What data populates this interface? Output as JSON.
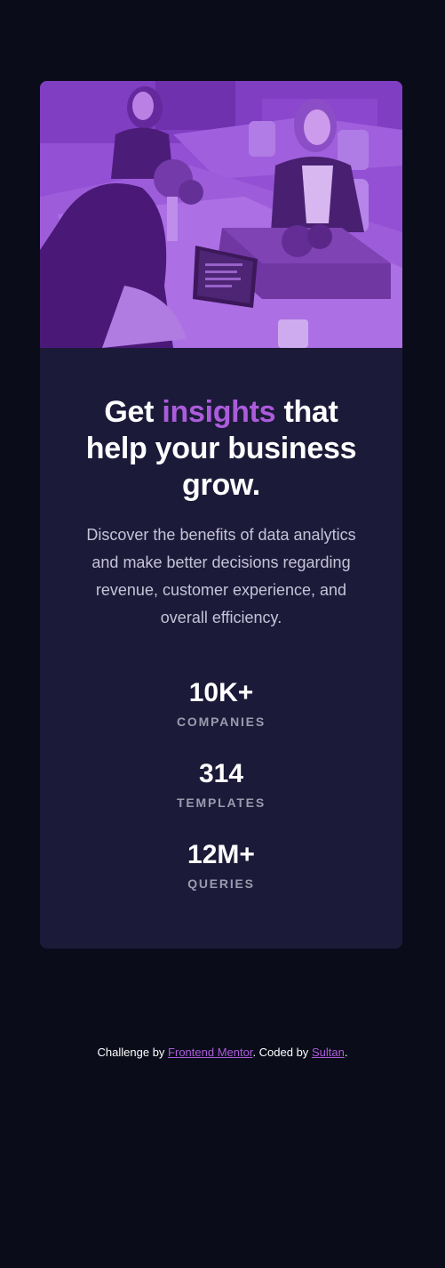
{
  "card": {
    "image_alt": "People working at laptops in an office",
    "title": {
      "part1": "Get ",
      "accent": "insights",
      "part2": " that help your business grow."
    },
    "description": "Discover the benefits of data analytics and make better decisions regarding revenue, customer experience, and overall efficiency.",
    "stats": [
      {
        "value": "10K+",
        "label": "COMPANIES"
      },
      {
        "value": "314",
        "label": "TEMPLATES"
      },
      {
        "value": "12M+",
        "label": "QUERIES"
      }
    ]
  },
  "attribution": {
    "prefix": "Challenge by ",
    "link1": "Frontend Mentor",
    "middle": ". Coded by ",
    "link2": "Sultan",
    "suffix": "."
  },
  "colors": {
    "background": "#0a0c1a",
    "card": "#1c1a39",
    "accent": "#ab5cdb",
    "image_tint": "#8e4fd0"
  }
}
